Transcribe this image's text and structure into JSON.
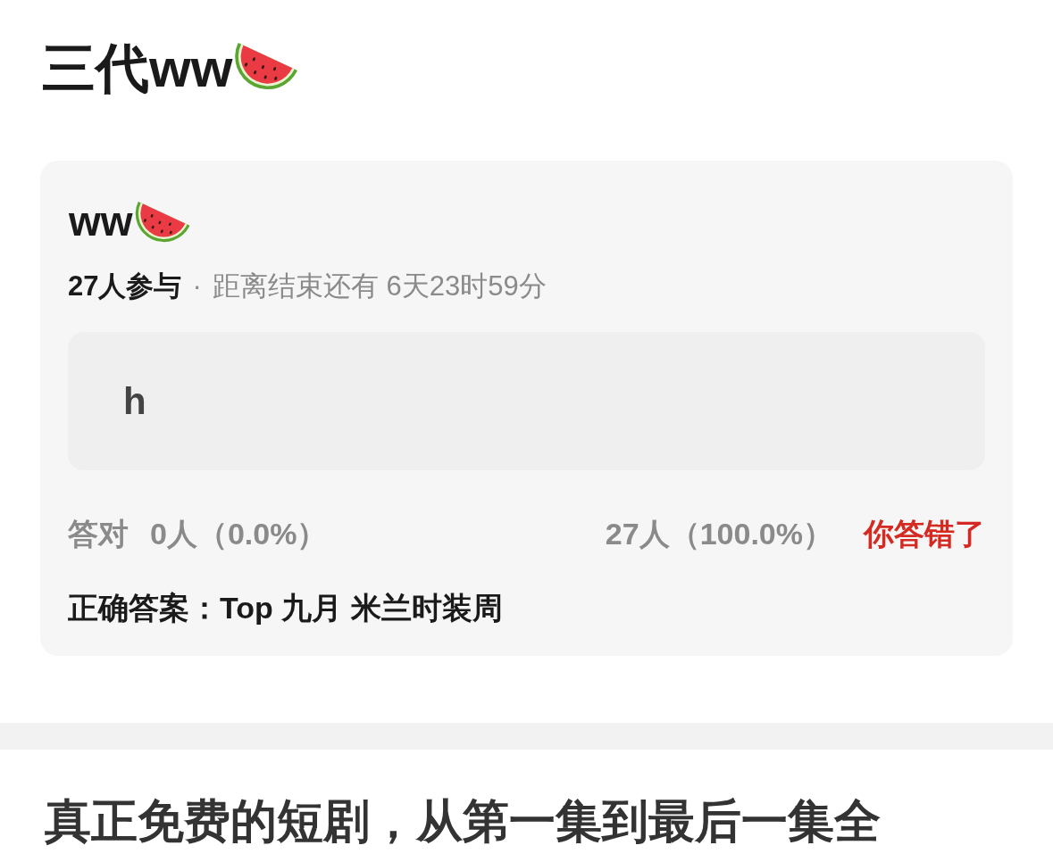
{
  "page_title": "三代ww",
  "quiz": {
    "title": "ww",
    "participants": "27人参与",
    "separator": "·",
    "countdown": "距离结束还有 6天23时59分",
    "answer": "h",
    "stats": {
      "correct_label": "答对",
      "correct_count": "0人（0.0%）",
      "wrong_count": "27人（100.0%）",
      "result": {
        "text": "你答错了",
        "correct": false
      }
    },
    "correct_answer": "正确答案：Top 九月 米兰时装周"
  },
  "next_article": {
    "headline": "真正免费的短剧，从第一集到最后一集全"
  }
}
